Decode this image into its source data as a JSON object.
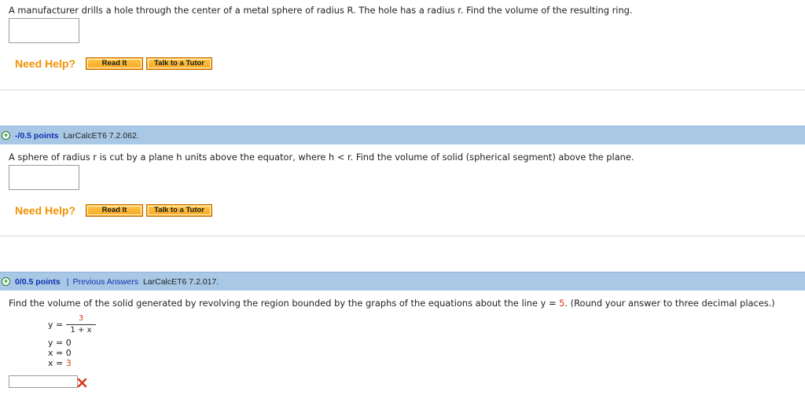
{
  "q1": {
    "text": "A manufacturer drills a hole through the center of a metal sphere of radius R. The hole has a radius r. Find the volume of the resulting ring.",
    "need_help": "Need Help?",
    "read_it": "Read It",
    "talk_tutor": "Talk to a Tutor"
  },
  "q2": {
    "points": "-/0.5 points",
    "source": "LarCalcET6 7.2.062.",
    "text": "A sphere of radius r is cut by a plane h units above the equator, where  h < r.  Find the volume of solid (spherical segment) above the plane.",
    "need_help": "Need Help?",
    "read_it": "Read It",
    "talk_tutor": "Talk to a Tutor"
  },
  "q3": {
    "points": "0/0.5 points",
    "pipe": "|",
    "previous_answers": "Previous Answers",
    "source": "LarCalcET6 7.2.017.",
    "text_before": "Find the volume of the solid generated by revolving the region bounded by the graphs of the equations about the line y = ",
    "line_value": "5",
    "text_after": ". (Round your answer to three decimal places.)",
    "eq1_lhs": "y =",
    "eq1_num": "3",
    "eq1_den": "1 + x",
    "eq2": "y = 0",
    "eq3": "x = 0",
    "eq4_lhs": "x = ",
    "eq4_val": "3",
    "answer_value": "",
    "result_icon": "x-mark-icon",
    "result_color": "#d63a1e"
  },
  "colors": {
    "help_orange": "#f39200",
    "bar_blue": "#a8c8e6",
    "points_blue": "#1030b0",
    "plus_green": "#1d7d1d"
  }
}
